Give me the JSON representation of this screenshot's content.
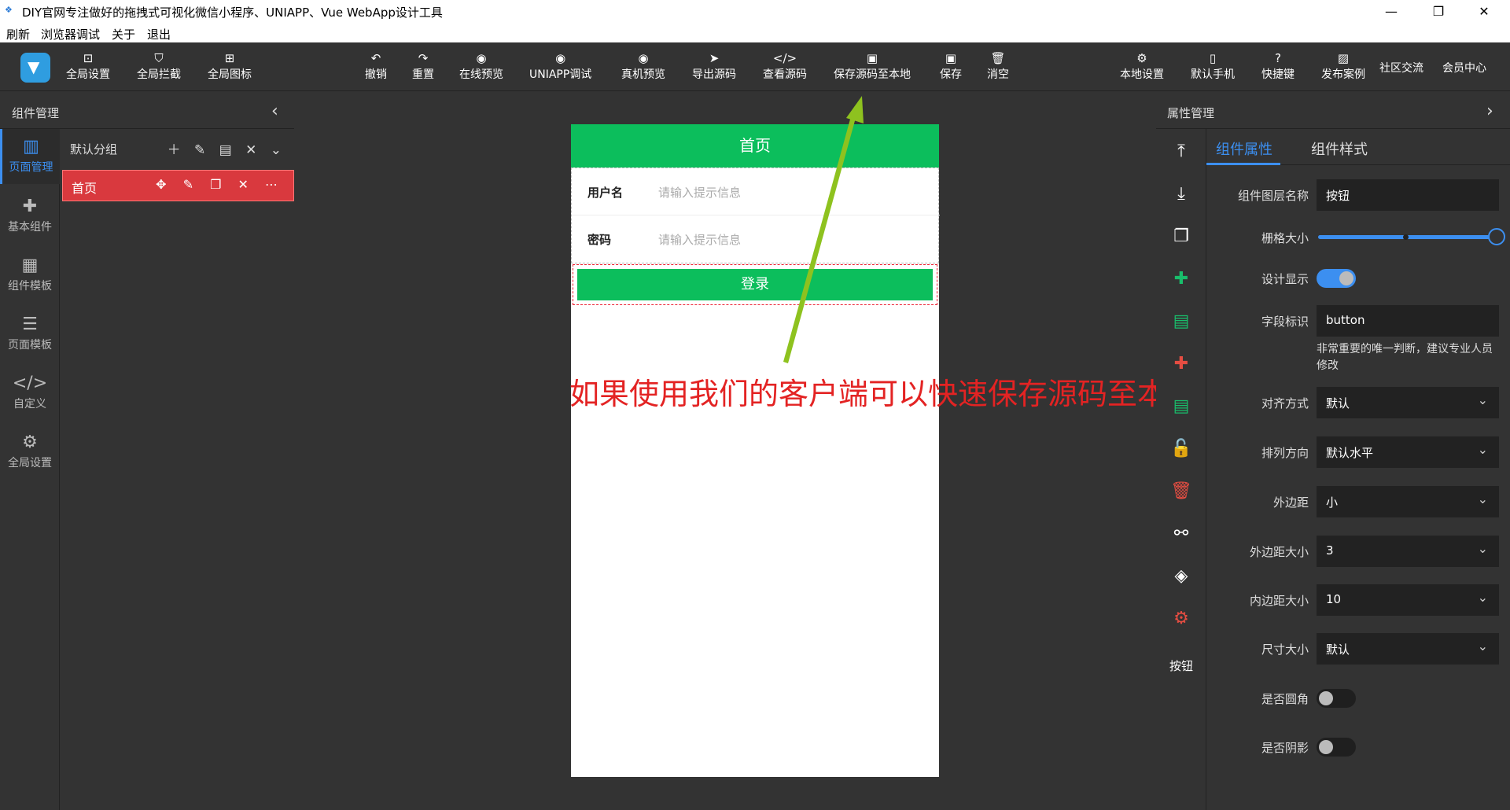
{
  "window": {
    "title": "DIY官网专注做好的拖拽式可视化微信小程序、UNIAPP、Vue WebApp设计工具",
    "minimize": "—",
    "maximize": "❐",
    "close": "✕"
  },
  "menu": [
    "刷新",
    "浏览器调试",
    "关于",
    "退出"
  ],
  "toolbar": {
    "left": [
      {
        "label": "全局设置",
        "icon": "window-code-icon",
        "glyph": "⊡"
      },
      {
        "label": "全局拦截",
        "icon": "shield-icon",
        "glyph": "⛉"
      },
      {
        "label": "全局图标",
        "icon": "icon-grid-icon",
        "glyph": "⊞"
      }
    ],
    "center": [
      {
        "label": "撤销",
        "icon": "undo-icon",
        "glyph": "↶"
      },
      {
        "label": "重置",
        "icon": "redo-icon",
        "glyph": "↷"
      },
      {
        "label": "在线预览",
        "icon": "eye-icon",
        "glyph": "◉"
      },
      {
        "label": "UNIAPP调试",
        "icon": "eye-icon",
        "glyph": "◉"
      },
      {
        "label": "真机预览",
        "icon": "eye-icon",
        "glyph": "◉"
      },
      {
        "label": "导出源码",
        "icon": "send-icon",
        "glyph": "➤"
      },
      {
        "label": "查看源码",
        "icon": "code-icon",
        "glyph": "</>"
      },
      {
        "label": "保存源码至本地",
        "icon": "floppy-icon",
        "glyph": "▣"
      },
      {
        "label": "保存",
        "icon": "floppy-icon",
        "glyph": "▣"
      },
      {
        "label": "消空",
        "icon": "trash-icon",
        "glyph": "🗑"
      }
    ],
    "right": [
      {
        "label": "本地设置",
        "icon": "gear-icon",
        "glyph": "⚙"
      },
      {
        "label": "默认手机",
        "icon": "phone-icon",
        "glyph": "▯"
      },
      {
        "label": "快捷键",
        "icon": "help-icon",
        "glyph": "?"
      },
      {
        "label": "发布案例",
        "icon": "image-icon",
        "glyph": "▨"
      },
      {
        "label": "社区交流",
        "icon": "",
        "glyph": ""
      },
      {
        "label": "会员中心",
        "icon": "",
        "glyph": ""
      }
    ]
  },
  "left_panel": {
    "title": "组件管理",
    "collapse": "‹",
    "nav": [
      {
        "label": "页面管理",
        "icon": "layout-icon",
        "glyph": "▥",
        "active": true
      },
      {
        "label": "基本组件",
        "icon": "puzzle-icon",
        "glyph": "✚"
      },
      {
        "label": "组件模板",
        "icon": "template-icon",
        "glyph": "▦"
      },
      {
        "label": "页面模板",
        "icon": "database-icon",
        "glyph": "☰"
      },
      {
        "label": "自定义",
        "icon": "code-icon",
        "glyph": "</>"
      },
      {
        "label": "全局设置",
        "icon": "gear-icon",
        "glyph": "⚙"
      }
    ],
    "group": {
      "label": "默认分组",
      "ops": "＋ ✎ ▤ ✕ ⌄"
    },
    "page": {
      "label": "首页",
      "ops": "✥ ✎ ❐ ✕ ⋯"
    }
  },
  "phone": {
    "title": "首页",
    "fields": [
      {
        "label": "用户名",
        "placeholder": "请输入提示信息"
      },
      {
        "label": "密码",
        "placeholder": "请输入提示信息"
      }
    ],
    "button": "登录"
  },
  "annotation": {
    "text": "如果使用我们的客户端可以快速保存源码至本地",
    "color": "#e32323",
    "arrow_color": "#8ec21f"
  },
  "right_panel": {
    "title": "属性管理",
    "collapse": "›",
    "tools": [
      {
        "icon": "move-top-icon",
        "glyph": "⤒",
        "color": "#ffffff"
      },
      {
        "icon": "move-bottom-icon",
        "glyph": "⤓",
        "color": "#ffffff"
      },
      {
        "icon": "copy-icon",
        "glyph": "❐",
        "color": "#ffffff"
      },
      {
        "icon": "puzzle-icon",
        "glyph": "✚",
        "color": "#19be6b"
      },
      {
        "icon": "document-icon",
        "glyph": "▤",
        "color": "#19be6b"
      },
      {
        "icon": "puzzle-icon",
        "glyph": "✚",
        "color": "#e54d42"
      },
      {
        "icon": "document-add-icon",
        "glyph": "▤",
        "color": "#19be6b"
      },
      {
        "icon": "unlock-icon",
        "glyph": "🔓",
        "color": "#ffffff"
      },
      {
        "icon": "trash-icon",
        "glyph": "🗑",
        "color": "#e54d42"
      },
      {
        "icon": "link-icon",
        "glyph": "⚯",
        "color": "#ffffff"
      },
      {
        "icon": "layers-icon",
        "glyph": "◈",
        "color": "#ffffff"
      },
      {
        "icon": "gear-icon",
        "glyph": "⚙",
        "color": "#e54d42"
      }
    ],
    "tool_label": "按钮",
    "tabs": [
      "组件属性",
      "组件样式"
    ],
    "props": {
      "layer_name": {
        "label": "组件图层名称",
        "value": "按钮"
      },
      "grid_size": {
        "label": "栅格大小",
        "level": 1.0
      },
      "design_show": {
        "label": "设计显示",
        "on": true
      },
      "field_id": {
        "label": "字段标识",
        "value": "button",
        "hint": "非常重要的唯一判断，建议专业人员修改"
      },
      "align": {
        "label": "对齐方式",
        "value": "默认"
      },
      "direction": {
        "label": "排列方向",
        "value": "默认水平"
      },
      "margin": {
        "label": "外边距",
        "value": "小"
      },
      "margin_size": {
        "label": "外边距大小",
        "value": "3"
      },
      "padding_size": {
        "label": "内边距大小",
        "value": "10"
      },
      "size": {
        "label": "尺寸大小",
        "value": "默认"
      },
      "rounded": {
        "label": "是否圆角",
        "on": false
      },
      "shadow": {
        "label": "是否阴影",
        "on": false
      }
    },
    "dropdown_glyph": "⌄"
  }
}
